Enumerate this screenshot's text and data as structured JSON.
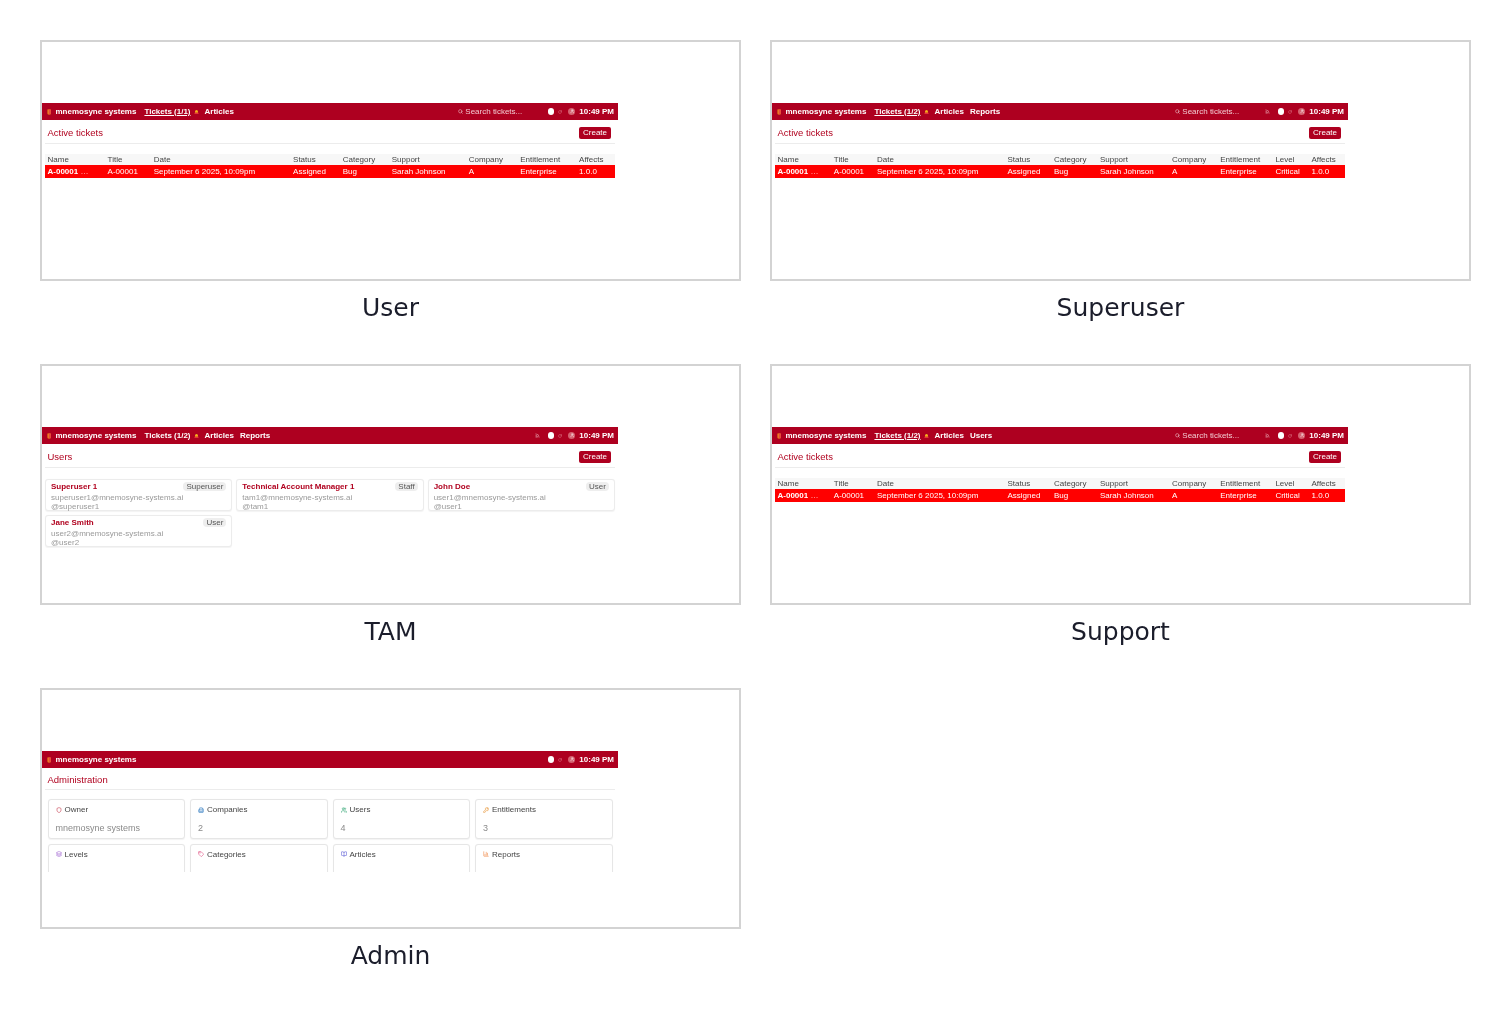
{
  "panels": [
    {
      "caption": "User",
      "app": {
        "brand": "mnemosyne systems",
        "nav": [
          {
            "label": "Tickets (1/1)",
            "selected": true,
            "alert": true
          },
          {
            "label": "Articles",
            "selected": false,
            "alert": false
          }
        ],
        "search": {
          "placeholder": "Search tickets..."
        },
        "clock": "10:49 PM",
        "page": {
          "kind": "tickets",
          "title": "Active tickets",
          "create": "Create",
          "columns": [
            "Name",
            "Title",
            "Date",
            "Status",
            "Category",
            "Support",
            "Company",
            "Entitlement",
            "Affects"
          ],
          "rows": [
            {
              "color": "#ff0000",
              "name_suffix": "…",
              "cells": [
                "A-00001",
                "A-00001",
                "September 6 2025, 10:09pm",
                "Assigned",
                "Bug",
                "Sarah Johnson",
                "A",
                "Enterprise",
                "1.0.0"
              ]
            }
          ]
        }
      }
    },
    {
      "caption": "Superuser",
      "app": {
        "brand": "mnemosyne systems",
        "nav": [
          {
            "label": "Tickets (1/2)",
            "selected": true,
            "alert": true
          },
          {
            "label": "Articles",
            "selected": false,
            "alert": false
          },
          {
            "label": "Reports",
            "selected": false,
            "alert": false
          }
        ],
        "search": {
          "placeholder": "Search tickets..."
        },
        "rss": true,
        "clock": "10:49 PM",
        "page": {
          "kind": "tickets",
          "title": "Active tickets",
          "create": "Create",
          "columns": [
            "Name",
            "Title",
            "Date",
            "Status",
            "Category",
            "Support",
            "Company",
            "Entitlement",
            "Level",
            "Affects"
          ],
          "rows": [
            {
              "color": "#ff0000",
              "name_suffix": "…",
              "cells": [
                "A-00001",
                "A-00001",
                "September 6 2025, 10:09pm",
                "Assigned",
                "Bug",
                "Sarah Johnson",
                "A",
                "Enterprise",
                "Critical",
                "1.0.0"
              ]
            }
          ]
        }
      }
    },
    {
      "caption": "TAM",
      "app": {
        "brand": "mnemosyne systems",
        "nav": [
          {
            "label": "Tickets (1/2)",
            "selected": false,
            "alert": true
          },
          {
            "label": "Articles",
            "selected": false,
            "alert": false
          },
          {
            "label": "Reports",
            "selected": false,
            "alert": false
          }
        ],
        "rss": true,
        "clock": "10:49 PM",
        "page": {
          "kind": "users",
          "title": "Users",
          "create": "Create",
          "cards": [
            {
              "name": "Superuser 1",
              "role": "Superuser",
              "email": "superuser1@mnemosyne-systems.ai",
              "username": "@superuser1"
            },
            {
              "name": "Technical Account Manager 1",
              "role": "Staff",
              "email": "tam1@mnemosyne-systems.ai",
              "username": "@tam1"
            },
            {
              "name": "John Doe",
              "role": "User",
              "email": "user1@mnemosyne-systems.ai",
              "username": "@user1"
            },
            {
              "name": "Jane Smith",
              "role": "User",
              "email": "user2@mnemosyne-systems.ai",
              "username": "@user2"
            }
          ]
        }
      }
    },
    {
      "caption": "Support",
      "app": {
        "brand": "mnemosyne systems",
        "nav": [
          {
            "label": "Tickets (1/2)",
            "selected": true,
            "alert": true
          },
          {
            "label": "Articles",
            "selected": false,
            "alert": false
          },
          {
            "label": "Users",
            "selected": false,
            "alert": false
          }
        ],
        "search": {
          "placeholder": "Search tickets..."
        },
        "rss": true,
        "clock": "10:49 PM",
        "page": {
          "kind": "tickets",
          "title": "Active tickets",
          "create": "Create",
          "columns": [
            "Name",
            "Title",
            "Date",
            "Status",
            "Category",
            "Support",
            "Company",
            "Entitlement",
            "Level",
            "Affects"
          ],
          "rows": [
            {
              "color": "#ff0000",
              "name_suffix": "…",
              "cells": [
                "A-00001",
                "A-00001",
                "September 6 2025, 10:09pm",
                "Assigned",
                "Bug",
                "Sarah Johnson",
                "A",
                "Enterprise",
                "Critical",
                "1.0.0"
              ]
            }
          ]
        }
      }
    },
    {
      "caption": "Admin",
      "app": {
        "brand": "mnemosyne systems",
        "clock": "10:49 PM",
        "page": {
          "kind": "admin",
          "title": "Administration",
          "cards": [
            {
              "kind": "owner",
              "label": "Owner",
              "value": "mnemosyne systems"
            },
            {
              "kind": "companies",
              "label": "Companies",
              "value": "2"
            },
            {
              "kind": "users",
              "label": "Users",
              "value": "4"
            },
            {
              "kind": "entitlements",
              "label": "Entitlements",
              "value": "3"
            },
            {
              "kind": "levels",
              "label": "Levels"
            },
            {
              "kind": "categories",
              "label": "Categories"
            },
            {
              "kind": "articles",
              "label": "Articles"
            },
            {
              "kind": "reports",
              "label": "Reports"
            }
          ]
        }
      }
    }
  ]
}
